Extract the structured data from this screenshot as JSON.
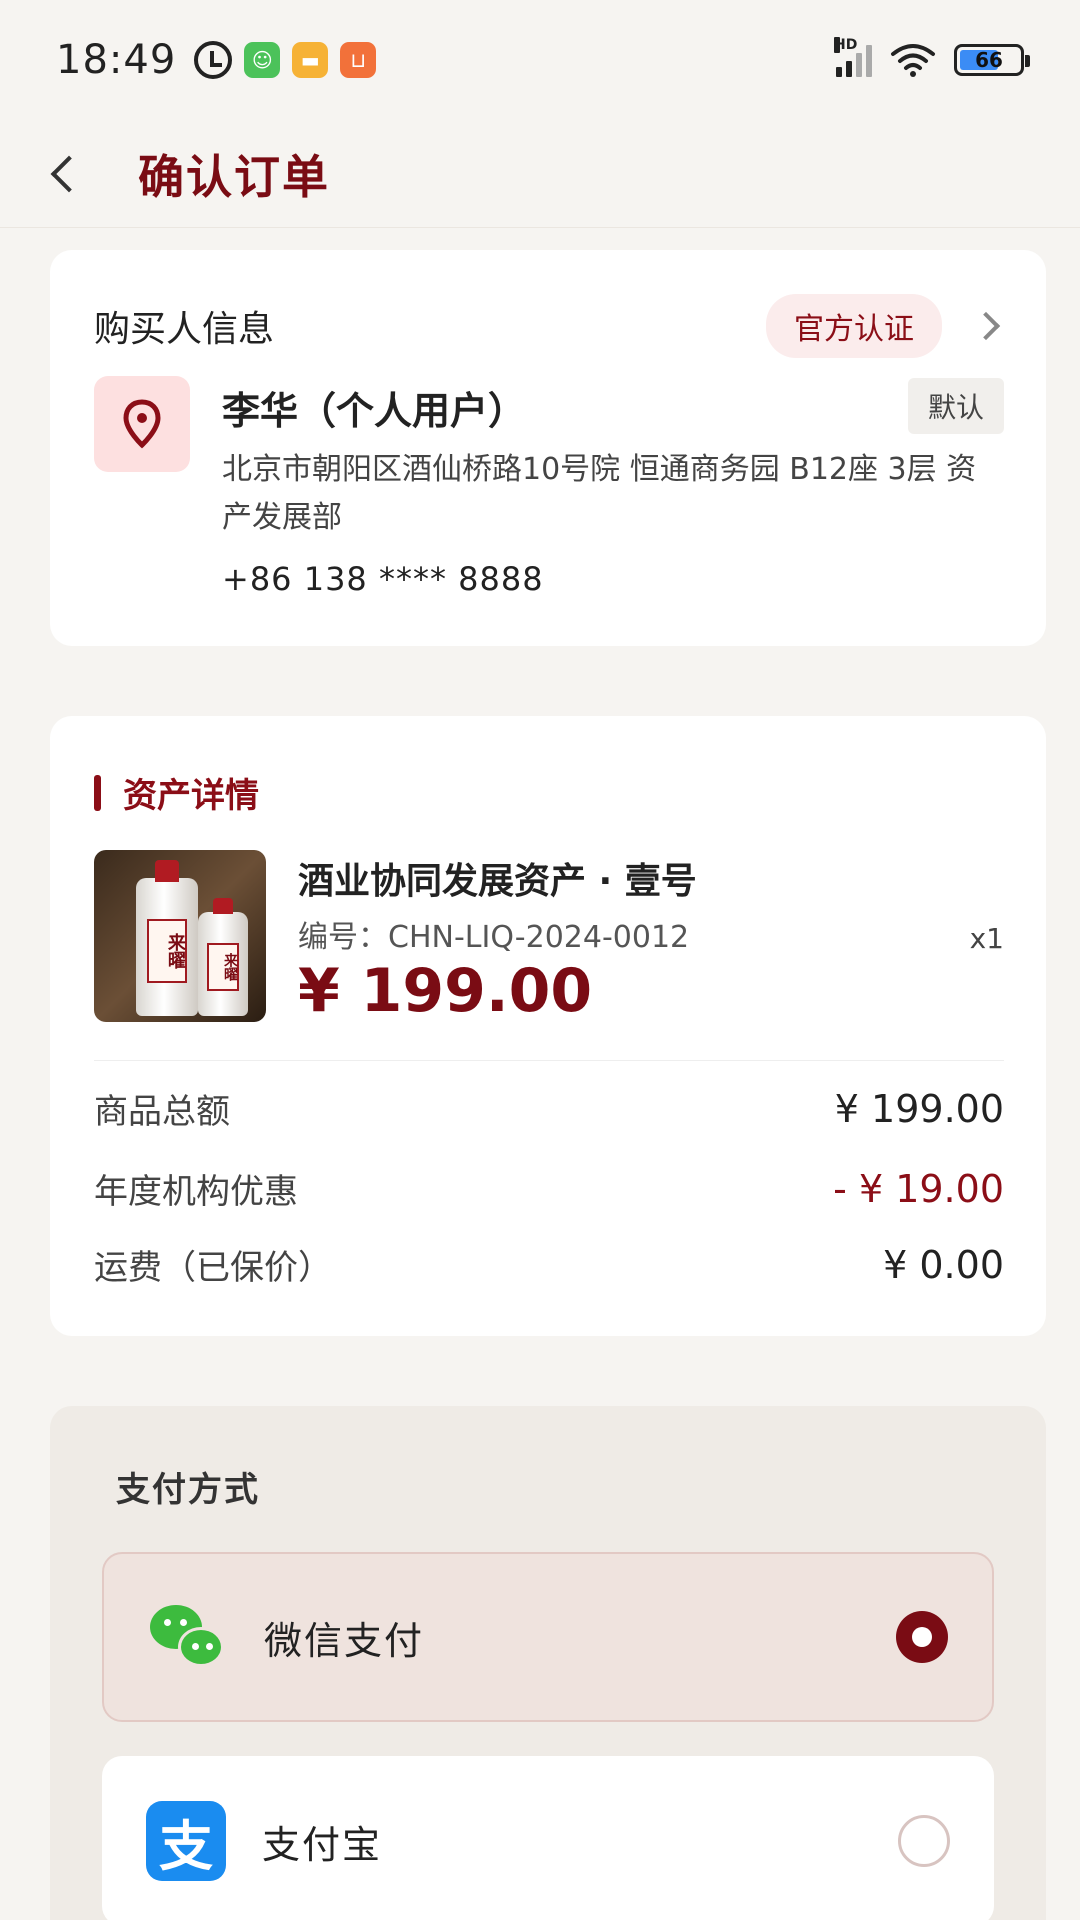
{
  "status_bar": {
    "time": "18:49",
    "network_label": "HD",
    "battery": "66",
    "icons": [
      "alarm-icon",
      "green-app-icon",
      "yellow-chat-icon",
      "orange-shop-icon",
      "signal-icon",
      "wifi-icon",
      "battery-icon"
    ]
  },
  "nav": {
    "title": "确认订单",
    "back_icon": "chevron-left-icon"
  },
  "buyer": {
    "heading": "购买人信息",
    "badge": "官方认证",
    "name": "李华（个人用户）",
    "default_tag": "默认",
    "address": "北京市朝阳区酒仙桥路10号院 恒通商务园 B12座 3层 资产发展部",
    "phone": "+86 138 **** 8888",
    "pin_icon": "location-pin-icon"
  },
  "asset": {
    "heading": "资产详情",
    "product": {
      "name": "酒业协同发展资产 · 壹号",
      "code": "编号：CHN-LIQ-2024-0012",
      "price": "¥ 199.00",
      "qty": "x1",
      "bottle_label": "来曜"
    },
    "summary": [
      {
        "label": "商品总额",
        "value": "¥ 199.00"
      },
      {
        "label": "年度机构优惠",
        "value": "- ¥ 19.00"
      },
      {
        "label": "运费（已保价）",
        "value": "¥ 0.00"
      }
    ]
  },
  "payment": {
    "heading": "支付方式",
    "options": [
      {
        "label": "微信支付",
        "icon": "wechat-icon",
        "selected": true
      },
      {
        "label": "支付宝",
        "icon": "alipay-icon",
        "selected": false
      }
    ],
    "alipay_glyph": "支"
  },
  "colors": {
    "brand": "#7a0c14",
    "background": "#f6f4f1",
    "wechat": "#3dbb3e",
    "alipay": "#1a8cf0"
  }
}
